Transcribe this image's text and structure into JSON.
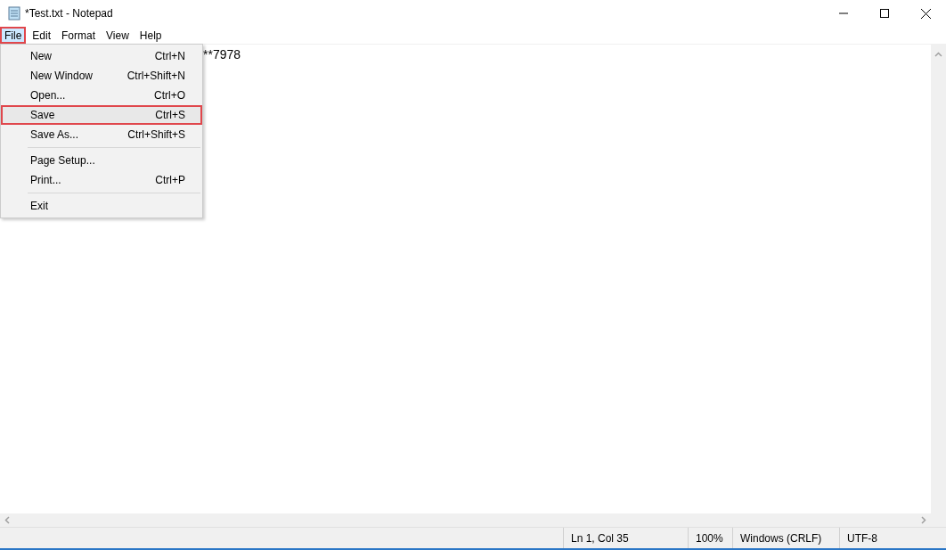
{
  "window": {
    "title": "*Test.txt - Notepad"
  },
  "menubar": [
    {
      "label": "File",
      "selected": true
    },
    {
      "label": "Edit",
      "selected": false
    },
    {
      "label": "Format",
      "selected": false
    },
    {
      "label": "View",
      "selected": false
    },
    {
      "label": "Help",
      "selected": false
    }
  ],
  "file_menu": [
    {
      "kind": "item",
      "label": "New",
      "shortcut": "Ctrl+N",
      "selected": false
    },
    {
      "kind": "item",
      "label": "New Window",
      "shortcut": "Ctrl+Shift+N",
      "selected": false
    },
    {
      "kind": "item",
      "label": "Open...",
      "shortcut": "Ctrl+O",
      "selected": false
    },
    {
      "kind": "item",
      "label": "Save",
      "shortcut": "Ctrl+S",
      "selected": true
    },
    {
      "kind": "item",
      "label": "Save As...",
      "shortcut": "Ctrl+Shift+S",
      "selected": false
    },
    {
      "kind": "separator"
    },
    {
      "kind": "item",
      "label": "Page Setup...",
      "selected": false
    },
    {
      "kind": "item",
      "label": "Print...",
      "shortcut": "Ctrl+P",
      "selected": false
    },
    {
      "kind": "separator"
    },
    {
      "kind": "item",
      "label": "Exit",
      "selected": false
    }
  ],
  "editor": {
    "text": "**7978"
  },
  "status_bar": [
    "Ln 1, Col 35",
    "100%",
    "Windows (CRLF)",
    "UTF-8"
  ]
}
